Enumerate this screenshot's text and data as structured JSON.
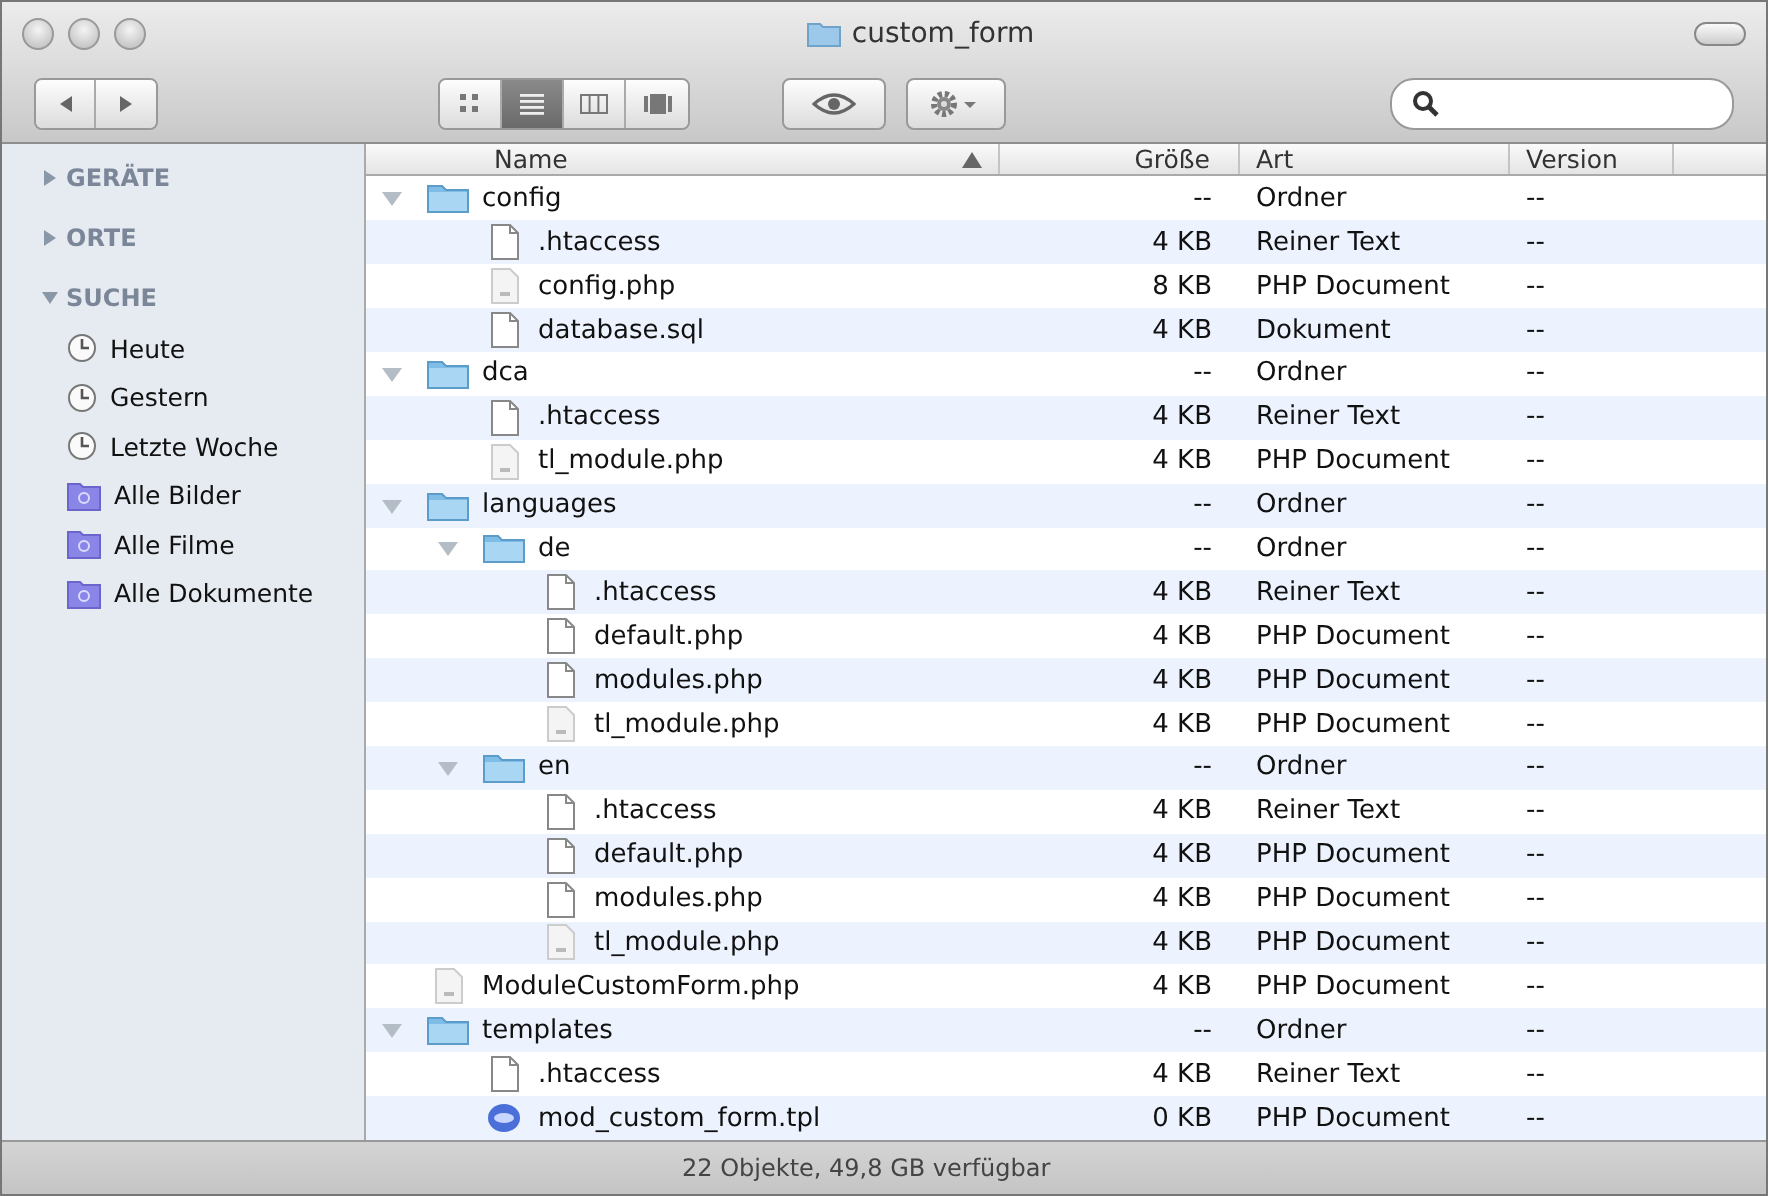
{
  "window": {
    "title": "custom_form"
  },
  "toolbar": {
    "views": [
      {
        "kind": "icons",
        "selected": false
      },
      {
        "kind": "list",
        "selected": true
      },
      {
        "kind": "columns",
        "selected": false
      },
      {
        "kind": "coverflow",
        "selected": false
      }
    ]
  },
  "sidebar": {
    "sections": [
      {
        "title": "GERÄTE",
        "expanded": false
      },
      {
        "title": "ORTE",
        "expanded": false
      },
      {
        "title": "SUCHE",
        "expanded": true,
        "items": [
          {
            "label": "Heute",
            "kind": "clock"
          },
          {
            "label": "Gestern",
            "kind": "clock"
          },
          {
            "label": "Letzte Woche",
            "kind": "clock"
          },
          {
            "label": "Alle Bilder",
            "kind": "smartfolder"
          },
          {
            "label": "Alle Filme",
            "kind": "smartfolder"
          },
          {
            "label": "Alle Dokumente",
            "kind": "smartfolder"
          }
        ]
      }
    ]
  },
  "table": {
    "columns": [
      {
        "label": "Name",
        "sorted": true
      },
      {
        "label": "Größe",
        "sorted": false
      },
      {
        "label": "Art",
        "sorted": false
      },
      {
        "label": "Version",
        "sorted": false
      }
    ],
    "rows": [
      {
        "name": "config",
        "kind": "folder",
        "expanded": true,
        "size": "--",
        "type": "Ordner",
        "version": "--",
        "children": [
          {
            "name": ".htaccess",
            "kind": "text",
            "size": "4 KB",
            "type": "Reiner Text",
            "version": "--"
          },
          {
            "name": "config.php",
            "kind": "php",
            "size": "8 KB",
            "type": "PHP Document",
            "version": "--"
          },
          {
            "name": "database.sql",
            "kind": "text",
            "size": "4 KB",
            "type": "Dokument",
            "version": "--"
          }
        ]
      },
      {
        "name": "dca",
        "kind": "folder",
        "expanded": true,
        "size": "--",
        "type": "Ordner",
        "version": "--",
        "children": [
          {
            "name": ".htaccess",
            "kind": "text",
            "size": "4 KB",
            "type": "Reiner Text",
            "version": "--"
          },
          {
            "name": "tl_module.php",
            "kind": "php",
            "size": "4 KB",
            "type": "PHP Document",
            "version": "--"
          }
        ]
      },
      {
        "name": "languages",
        "kind": "folder",
        "expanded": true,
        "size": "--",
        "type": "Ordner",
        "version": "--",
        "children": [
          {
            "name": "de",
            "kind": "folder",
            "expanded": true,
            "size": "--",
            "type": "Ordner",
            "version": "--",
            "children": [
              {
                "name": ".htaccess",
                "kind": "text",
                "size": "4 KB",
                "type": "Reiner Text",
                "version": "--"
              },
              {
                "name": "default.php",
                "kind": "text",
                "size": "4 KB",
                "type": "PHP Document",
                "version": "--"
              },
              {
                "name": "modules.php",
                "kind": "text",
                "size": "4 KB",
                "type": "PHP Document",
                "version": "--"
              },
              {
                "name": "tl_module.php",
                "kind": "php",
                "size": "4 KB",
                "type": "PHP Document",
                "version": "--"
              }
            ]
          },
          {
            "name": "en",
            "kind": "folder",
            "expanded": true,
            "size": "--",
            "type": "Ordner",
            "version": "--",
            "children": [
              {
                "name": ".htaccess",
                "kind": "text",
                "size": "4 KB",
                "type": "Reiner Text",
                "version": "--"
              },
              {
                "name": "default.php",
                "kind": "text",
                "size": "4 KB",
                "type": "PHP Document",
                "version": "--"
              },
              {
                "name": "modules.php",
                "kind": "text",
                "size": "4 KB",
                "type": "PHP Document",
                "version": "--"
              },
              {
                "name": "tl_module.php",
                "kind": "php",
                "size": "4 KB",
                "type": "PHP Document",
                "version": "--"
              }
            ]
          }
        ]
      },
      {
        "name": "ModuleCustomForm.php",
        "kind": "php",
        "size": "4 KB",
        "type": "PHP Document",
        "version": "--"
      },
      {
        "name": "templates",
        "kind": "folder",
        "expanded": true,
        "size": "--",
        "type": "Ordner",
        "version": "--",
        "children": [
          {
            "name": ".htaccess",
            "kind": "text",
            "size": "4 KB",
            "type": "Reiner Text",
            "version": "--"
          },
          {
            "name": "mod_custom_form.tpl",
            "kind": "phpbadge",
            "size": "0 KB",
            "type": "PHP Document",
            "version": "--"
          }
        ]
      }
    ]
  },
  "status_bar": {
    "text": "22 Objekte, 49,8 GB verfügbar"
  }
}
